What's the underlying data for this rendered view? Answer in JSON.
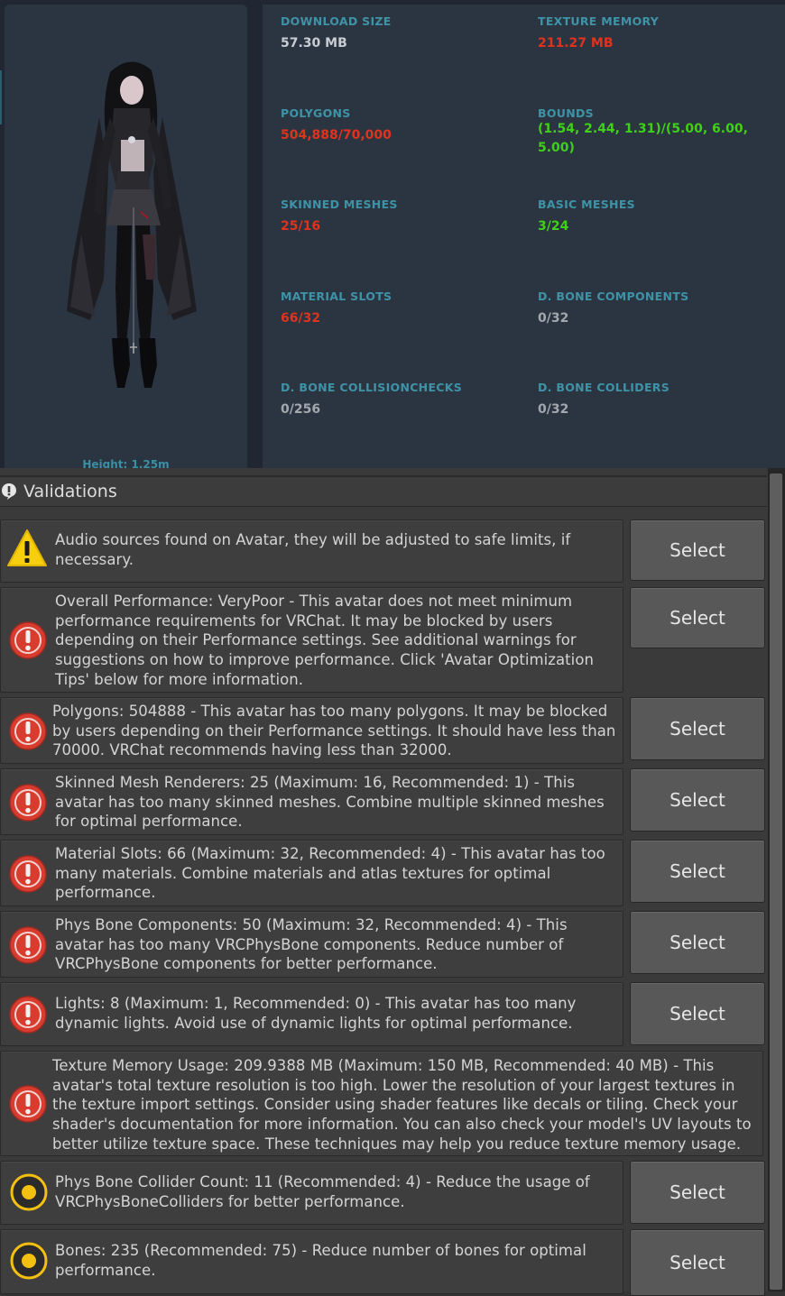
{
  "preview": {
    "height_label": "Height: 1.25m"
  },
  "stats": {
    "download_size": {
      "label": "DOWNLOAD SIZE",
      "value": "57.30 MB"
    },
    "texture_memory": {
      "label": "TEXTURE MEMORY",
      "value": "211.27 MB"
    },
    "polygons": {
      "label": "POLYGONS",
      "value": "504,888/70,000"
    },
    "bounds": {
      "label": "BOUNDS",
      "value": "(1.54, 2.44, 1.31)/(5.00, 6.00, 5.00)"
    },
    "skinned_meshes": {
      "label": "SKINNED MESHES",
      "value": "25/16"
    },
    "basic_meshes": {
      "label": "BASIC MESHES",
      "value": "3/24"
    },
    "material_slots": {
      "label": "MATERIAL SLOTS",
      "value": "66/32"
    },
    "dbone_components": {
      "label": "D. BONE COMPONENTS",
      "value": "0/32"
    },
    "dbone_collisionchecks": {
      "label": "D. BONE COLLISIONCHECKS",
      "value": "0/256"
    },
    "dbone_colliders": {
      "label": "D. BONE COLLIDERS",
      "value": "0/32"
    }
  },
  "colors": {
    "red": "#e0331e",
    "green": "#3fd017",
    "white": "#c9cdd2",
    "gray": "#a3a8ae",
    "label": "#3f93a7"
  },
  "validations": {
    "title": "Validations",
    "select_label": "Select",
    "items": [
      {
        "icon": "warning-icon",
        "text": "Audio sources found on Avatar, they will be adjusted to safe limits, if necessary."
      },
      {
        "icon": "error-icon",
        "text": "Overall Performance: VeryPoor - This avatar does not meet minimum performance requirements for VRChat. It may be blocked by users depending on their Performance settings. See additional warnings for suggestions on how to improve performance. Click 'Avatar Optimization Tips' below for more information."
      },
      {
        "icon": "error-icon",
        "text": "Polygons: 504888 - This avatar has too many polygons. It may be blocked by users depending on their Performance settings. It should have less than 70000. VRChat recommends having less than 32000."
      },
      {
        "icon": "error-icon",
        "text": "Skinned Mesh Renderers: 25 (Maximum: 16, Recommended: 1) - This avatar has too many skinned meshes. Combine multiple skinned meshes for optimal performance."
      },
      {
        "icon": "error-icon",
        "text": "Material Slots: 66 (Maximum: 32, Recommended: 4) - This avatar has too many materials. Combine materials and atlas textures for optimal performance."
      },
      {
        "icon": "error-icon",
        "text": "Phys Bone Components: 50 (Maximum: 32, Recommended: 4) - This avatar has too many VRCPhysBone components. Reduce number of VRCPhysBone components for better performance."
      },
      {
        "icon": "error-icon",
        "text": "Lights: 8 (Maximum: 1, Recommended: 0) - This avatar has too many dynamic lights. Avoid use of dynamic lights for optimal performance."
      },
      {
        "icon": "error-icon",
        "text": "Texture Memory Usage: 209.9388 MB (Maximum: 150 MB, Recommended: 40 MB) - This avatar's total texture resolution is too high. Lower the resolution of your largest textures in the texture import settings. Consider using shader features like decals or tiling. Check your shader's documentation for more information. You can also check your model's UV layouts to better utilize texture space. These techniques may help you reduce texture memory usage."
      },
      {
        "icon": "info-circle-icon",
        "text": "Phys Bone Collider Count: 11 (Recommended: 4) - Reduce the usage of VRCPhysBoneColliders for better performance."
      },
      {
        "icon": "info-circle-icon",
        "text": "Bones: 235 (Recommended: 75) - Reduce number of bones for optimal performance."
      }
    ]
  }
}
